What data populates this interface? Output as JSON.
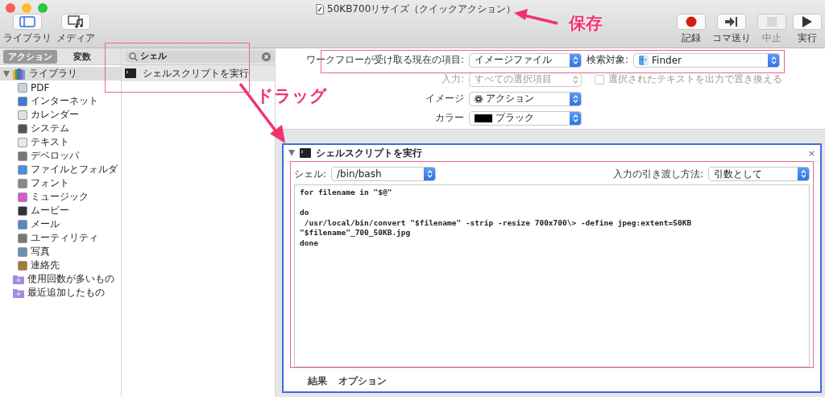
{
  "window": {
    "title": "50KB700リサイズ（クイックアクション）"
  },
  "toolbar_left": [
    {
      "label": "ライブラリ",
      "kind": "library"
    },
    {
      "label": "メディア",
      "kind": "media"
    }
  ],
  "toolbar_right": [
    {
      "label": "記録",
      "kind": "record",
      "disabled": false
    },
    {
      "label": "コマ送り",
      "kind": "step",
      "disabled": false
    },
    {
      "label": "中止",
      "kind": "stop",
      "disabled": true
    },
    {
      "label": "実行",
      "kind": "run",
      "disabled": false
    }
  ],
  "library_tabs": [
    {
      "label": "アクション",
      "selected": true
    },
    {
      "label": "変数",
      "selected": false
    }
  ],
  "tree": [
    {
      "label": "ライブラリ",
      "expanded": true,
      "selected": true,
      "children": [
        {
          "label": "PDF",
          "selected": false
        },
        {
          "label": "インターネット",
          "selected": false
        },
        {
          "label": "カレンダー",
          "selected": false
        },
        {
          "label": "システム",
          "selected": false
        },
        {
          "label": "テキスト",
          "selected": false
        },
        {
          "label": "デベロッパ",
          "selected": false
        },
        {
          "label": "ファイルとフォルダ",
          "selected": false
        },
        {
          "label": "フォント",
          "selected": false
        },
        {
          "label": "ミュージック",
          "selected": false
        },
        {
          "label": "ムービー",
          "selected": false
        },
        {
          "label": "メール",
          "selected": false
        },
        {
          "label": "ユーティリティ",
          "selected": false
        },
        {
          "label": "写真",
          "selected": false
        },
        {
          "label": "連絡先",
          "selected": false
        }
      ]
    },
    {
      "label": "使用回数が多いもの",
      "selected": false
    },
    {
      "label": "最近追加したもの",
      "selected": false
    }
  ],
  "search": {
    "value": "シェル"
  },
  "actions": [
    {
      "label": "シェルスクリプトを実行"
    }
  ],
  "workflow_settings": {
    "receives_label": "ワークフローが受け取る現在の項目:",
    "receives_value": "イメージファイル",
    "search_label": "検索対象:",
    "search_value": "Finder",
    "input_label": "入力:",
    "input_value": "すべての選択項目",
    "input_disabled": true,
    "replace_label": "選択されたテキストを出力で置き換える",
    "replace_checked": false,
    "replace_disabled": true,
    "image_label": "イメージ",
    "image_value": "アクション",
    "color_label": "カラー",
    "color_value": "ブラック"
  },
  "action_card": {
    "title": "シェルスクリプトを実行",
    "expanded": true,
    "close": "×",
    "shell_label": "シェル:",
    "shell_value": "/bin/bash",
    "pass_label": "入力の引き渡し方法:",
    "pass_value": "引数として",
    "script_lines": [
      {
        "text": "for filename in \"$@\""
      },
      {
        "text": "do",
        "blank_before": true
      },
      {
        "text": " /usr/local/bin/convert \"$filename\" -strip -resize 700x700\\> -define jpeg:extent=50KB"
      },
      {
        "text": "\"$filename\"_700_50KB.jpg"
      },
      {
        "text": "done"
      }
    ],
    "footer_tabs": [
      {
        "label": "結果"
      },
      {
        "label": "オプション"
      }
    ]
  },
  "annotations": [
    {
      "text": "保存"
    },
    {
      "text": "ドラッグ"
    }
  ]
}
